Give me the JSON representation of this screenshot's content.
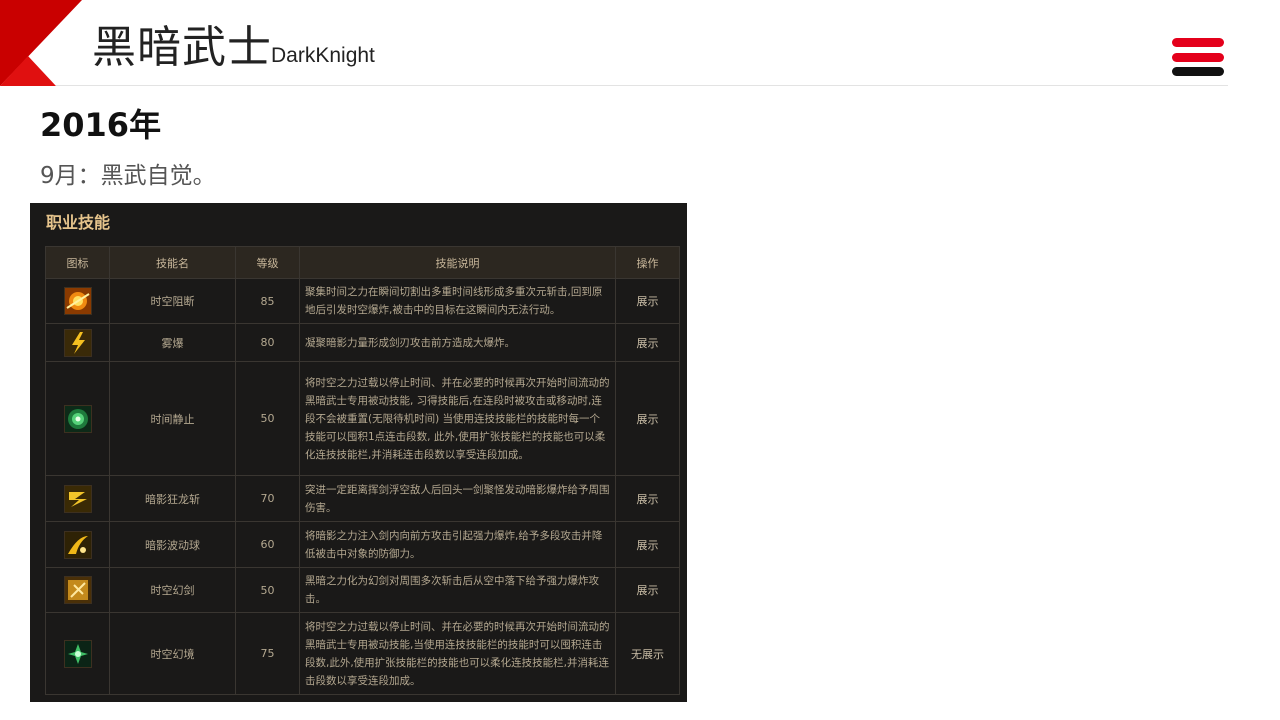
{
  "header": {
    "title_zh": "黑暗武士",
    "title_en": "DarkKnight"
  },
  "content": {
    "year": "2016年",
    "event": "9月：黑武自觉。"
  },
  "panel": {
    "title": "职业技能",
    "columns": [
      "图标",
      "技能名",
      "等级",
      "技能说明",
      "操作"
    ],
    "rows": [
      {
        "icon": "flame-burst-icon",
        "name": "时空阻断",
        "level": "85",
        "desc": "聚集时间之力在瞬间切割出多重时间线形成多重次元斩击,回到原地后引发时空爆炸,被击中的目标在这瞬间内无法行动。",
        "action": "展示"
      },
      {
        "icon": "lightning-slash-icon",
        "name": "雾爆",
        "level": "80",
        "desc": "凝聚暗影力量形成剑刃攻击前方造成大爆炸。",
        "action": "展示"
      },
      {
        "icon": "green-orb-icon",
        "name": "时间静止",
        "level": "50",
        "desc": "将时空之力过载以停止时间、并在必要的时候再次开始时间流动的黑暗武士专用被动技能, 习得技能后,在连段时被攻击或移动时,连段不会被重置(无限待机时间) 当使用连技技能栏的技能时每一个技能可以囤积1点连击段数, 此外,使用扩张技能栏的技能也可以柔化连技技能栏,并消耗连击段数以享受连段加成。",
        "action": "展示"
      },
      {
        "icon": "dragon-strike-icon",
        "name": "暗影狂龙斩",
        "level": "70",
        "desc": "突进一定距离挥剑浮空敌人后回头一剑聚怪发动暗影爆炸给予周围伤害。",
        "action": "展示"
      },
      {
        "icon": "shadow-wave-icon",
        "name": "暗影波动球",
        "level": "60",
        "desc": "将暗影之力注入剑内向前方攻击引起强力爆炸,给予多段攻击并降低被击中对象的防御力。",
        "action": "展示"
      },
      {
        "icon": "phantom-sword-icon",
        "name": "时空幻剑",
        "level": "50",
        "desc": "黑暗之力化为幻剑对周围多次斩击后从空中落下给予强力爆炸攻击。",
        "action": "展示"
      },
      {
        "icon": "green-swirl-icon",
        "name": "时空幻境",
        "level": "75",
        "desc": "将时空之力过载以停止时间、并在必要的时候再次开始时间流动的黑暗武士专用被动技能,当使用连技技能栏的技能时可以囤积连击段数,此外,使用扩张技能栏的技能也可以柔化连技技能栏,并消耗连击段数以享受连段加成。",
        "action": "无展示"
      }
    ]
  },
  "colors": {
    "brand_red": "#d40000",
    "panel_bg": "#1a1918",
    "gold_text": "#e6c48c"
  }
}
